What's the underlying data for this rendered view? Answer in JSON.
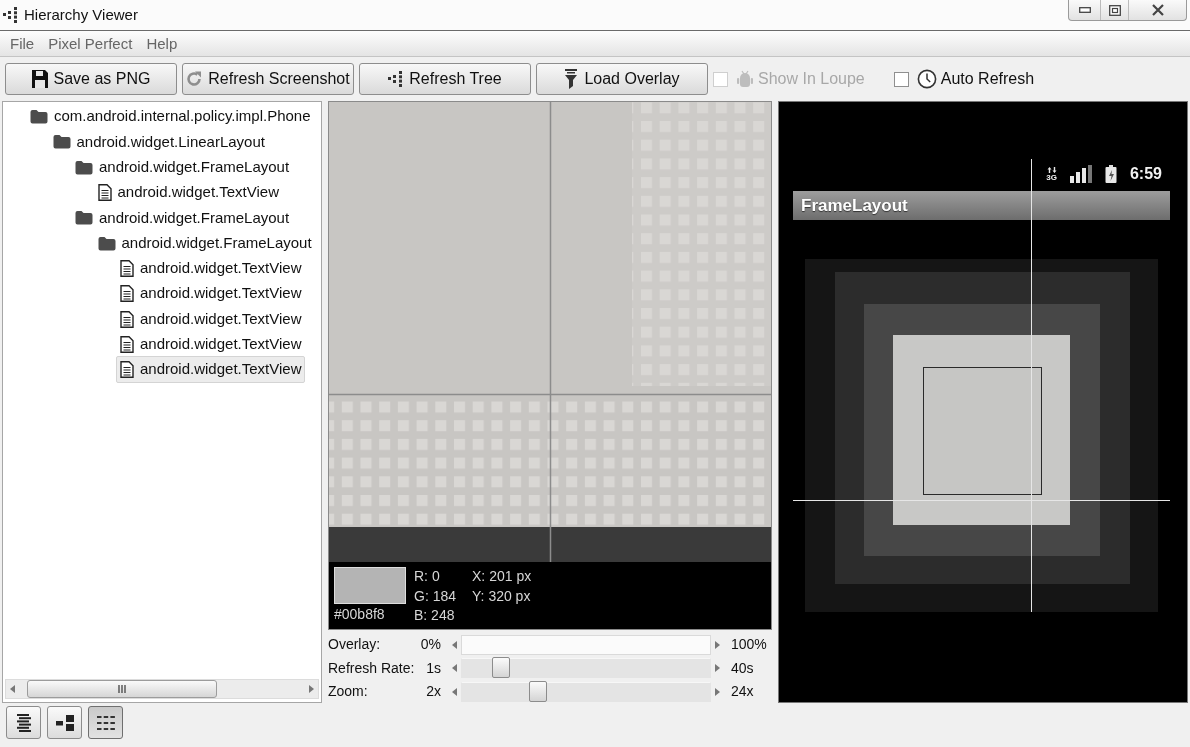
{
  "window": {
    "title": "Hierarchy Viewer"
  },
  "menu": [
    {
      "label": "File"
    },
    {
      "label": "Pixel Perfect"
    },
    {
      "label": "Help"
    }
  ],
  "toolbar": [
    {
      "kind": "button",
      "label": "Save as PNG"
    },
    {
      "kind": "button",
      "label": "Refresh Screenshot"
    },
    {
      "kind": "button",
      "label": "Refresh Tree"
    },
    {
      "kind": "button",
      "label": "Load Overlay"
    },
    {
      "kind": "checkbox",
      "label": "Show In Loupe",
      "checked": false,
      "disabled": true
    },
    {
      "kind": "checkbox",
      "label": "Auto Refresh",
      "checked": false,
      "disabled": false
    }
  ],
  "tree": {
    "nodes": [
      {
        "kind": "folder",
        "label": "com.android.internal.policy.impl.Phone",
        "selected": false,
        "children": [
          {
            "kind": "folder",
            "label": "android.widget.LinearLayout",
            "selected": false,
            "children": [
              {
                "kind": "folder",
                "label": "android.widget.FrameLayout",
                "selected": false,
                "children": [
                  {
                    "kind": "file",
                    "label": "android.widget.TextView",
                    "selected": false
                  }
                ]
              },
              {
                "kind": "folder",
                "label": "android.widget.FrameLayout",
                "selected": false,
                "children": [
                  {
                    "kind": "folder",
                    "label": "android.widget.FrameLayout",
                    "selected": false,
                    "children": [
                      {
                        "kind": "file",
                        "label": "android.widget.TextView",
                        "selected": false
                      },
                      {
                        "kind": "file",
                        "label": "android.widget.TextView",
                        "selected": false
                      },
                      {
                        "kind": "file",
                        "label": "android.widget.TextView",
                        "selected": false
                      },
                      {
                        "kind": "file",
                        "label": "android.widget.TextView",
                        "selected": false
                      },
                      {
                        "kind": "file",
                        "label": "android.widget.TextView",
                        "selected": true
                      }
                    ]
                  }
                ]
              }
            ]
          }
        ]
      }
    ]
  },
  "loupe": {
    "hex": "#00b8f8",
    "rgb": [
      "R: 0",
      "G: 184",
      "B: 248"
    ],
    "position": [
      "X: 201 px",
      "Y: 320 px"
    ]
  },
  "sliders": [
    {
      "label": "Overlay:",
      "min": "0%",
      "max": "100%",
      "disabled": true
    },
    {
      "label": "Refresh Rate:",
      "min": "1s",
      "max": "40s",
      "disabled": false,
      "level": 0.13
    },
    {
      "label": "Zoom:",
      "min": "2x",
      "max": "24x",
      "disabled": false,
      "level": 0.29
    }
  ],
  "preview": {
    "status_bar": {
      "network": "3G",
      "time": "6:59"
    },
    "title": "FrameLayout"
  },
  "view_modes": [
    {
      "selected": false
    },
    {
      "selected": false
    },
    {
      "selected": true
    }
  ]
}
